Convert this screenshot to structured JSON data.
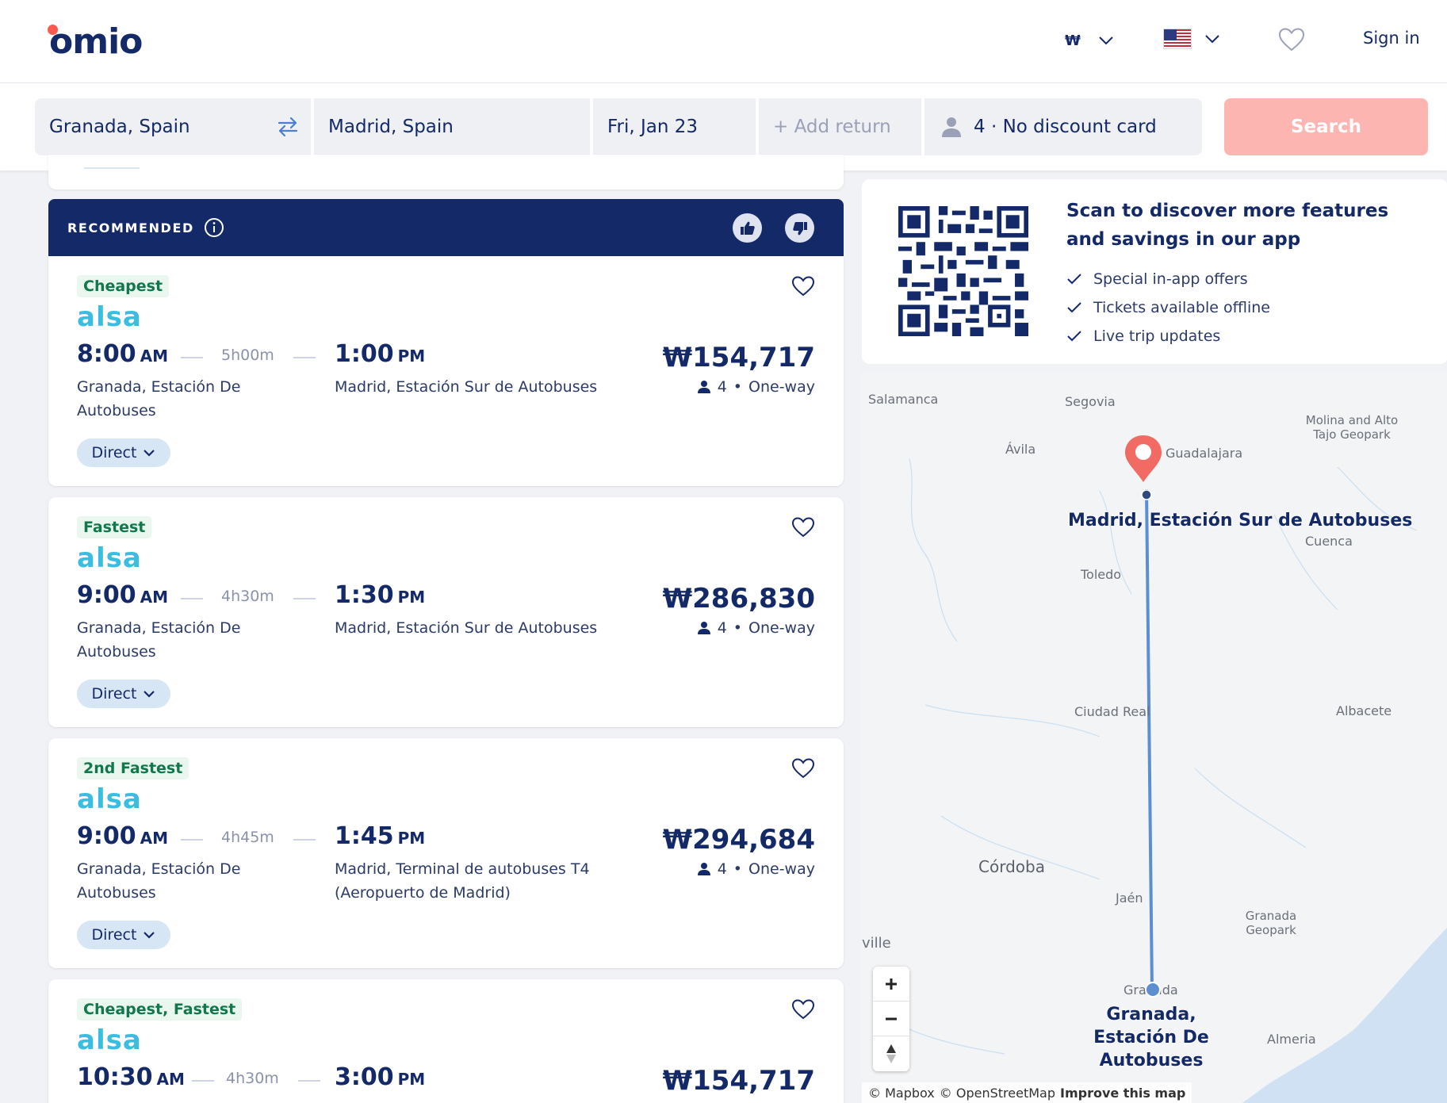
{
  "header": {
    "logo_text": "omio",
    "currency": "₩",
    "language_flag": "us-flag",
    "signin_label": "Sign in"
  },
  "search": {
    "from": "Granada, Spain",
    "to": "Madrid, Spain",
    "date": "Fri, Jan 23",
    "return_placeholder": "+ Add return",
    "passengers": "4 · No discount card",
    "button_label": "Search"
  },
  "results": {
    "banner_label": "RECOMMENDED",
    "cards": [
      {
        "badge": "Cheapest",
        "carrier": "alsa",
        "dep_time": "8:00",
        "dep_ampm": "AM",
        "duration": "5h00m",
        "arr_time": "1:00",
        "arr_ampm": "PM",
        "dep_station": "Granada, Estación De Autobuses",
        "arr_station": "Madrid, Estación Sur de Autobuses",
        "price": "₩154,717",
        "passengers": "4",
        "trip_type": "One-way",
        "stops_label": "Direct"
      },
      {
        "badge": "Fastest",
        "carrier": "alsa",
        "dep_time": "9:00",
        "dep_ampm": "AM",
        "duration": "4h30m",
        "arr_time": "1:30",
        "arr_ampm": "PM",
        "dep_station": "Granada, Estación De Autobuses",
        "arr_station": "Madrid, Estación Sur de Autobuses",
        "price": "₩286,830",
        "passengers": "4",
        "trip_type": "One-way",
        "stops_label": "Direct"
      },
      {
        "badge": "2nd Fastest",
        "carrier": "alsa",
        "dep_time": "9:00",
        "dep_ampm": "AM",
        "duration": "4h45m",
        "arr_time": "1:45",
        "arr_ampm": "PM",
        "dep_station": "Granada, Estación De Autobuses",
        "arr_station": "Madrid, Terminal de autobuses T4 (Aeropuerto de Madrid)",
        "price": "₩294,684",
        "passengers": "4",
        "trip_type": "One-way",
        "stops_label": "Direct"
      },
      {
        "badge": "Cheapest, Fastest",
        "carrier": "alsa",
        "dep_time": "10:30",
        "dep_ampm": "AM",
        "duration": "4h30m",
        "arr_time": "3:00",
        "arr_ampm": "PM",
        "price": "₩154,717"
      }
    ]
  },
  "app_promo": {
    "title": "Scan to discover more features and savings in our app",
    "features": [
      "Special in-app offers",
      "Tickets available offline",
      "Live trip updates"
    ]
  },
  "map": {
    "cities": {
      "salamanca": "Salamanca",
      "segovia": "Segovia",
      "avila": "Ávila",
      "guadalajara": "Guadalajara",
      "molina": "Molina and Alto Tajo Geopark",
      "cuenca": "Cuenca",
      "toledo": "Toledo",
      "ciudad_real": "Ciudad Real",
      "albacete": "Albacete",
      "cordoba": "Córdoba",
      "jaen": "Jaén",
      "granada_geopark": "Granada Geopark",
      "sevilla_partial": "ville",
      "granada": "Granada",
      "almeria": "Almeria"
    },
    "destination_label": "Madrid, Estación Sur de Autobuses",
    "origin_label": "Granada, Estación De Autobuses",
    "attribution_mapbox": "© Mapbox",
    "attribution_osm": "© OpenStreetMap",
    "attribution_improve": "Improve this map",
    "route_color": "#5b8fd1",
    "pin_color": "#f26a64"
  },
  "colors": {
    "brand_navy": "#132968",
    "brand_coral": "#fb5a4f",
    "search_button": "#fcb5b0",
    "badge_green": "#10784a",
    "carrier_blue": "#39bde0"
  }
}
